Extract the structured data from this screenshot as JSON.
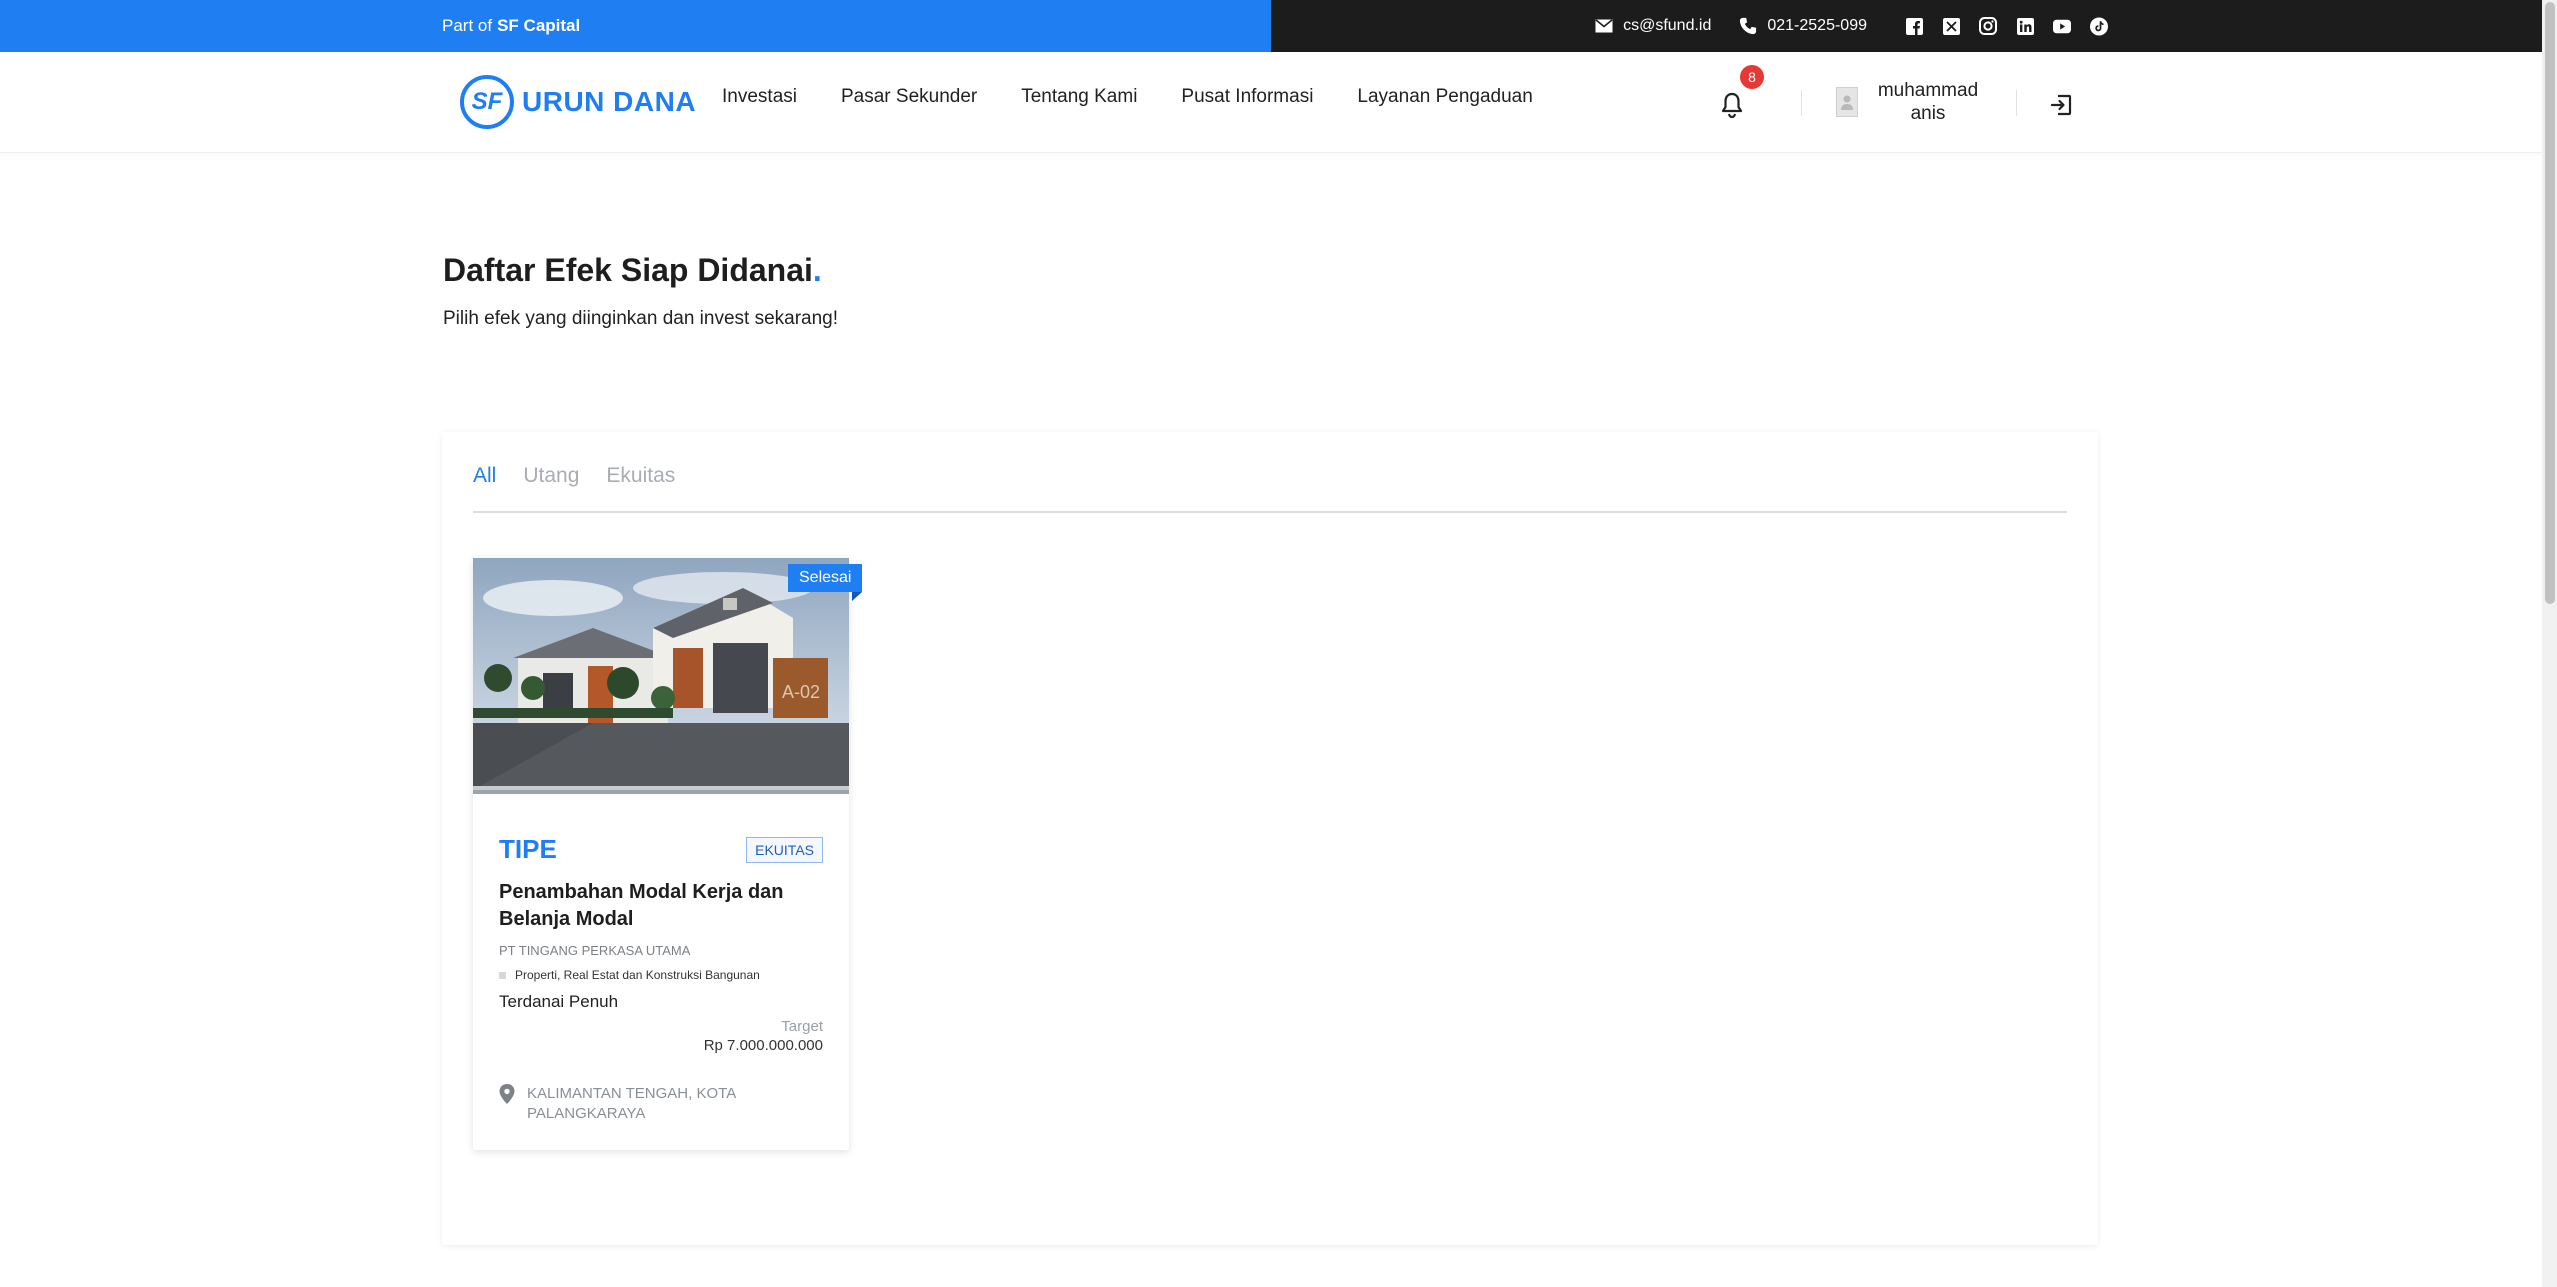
{
  "topbar": {
    "part_of": "Part of",
    "brand": "SF Capital",
    "email": "cs@sfund.id",
    "phone": "021-2525-099",
    "socials": [
      "facebook-icon",
      "x-icon",
      "instagram-icon",
      "linkedin-icon",
      "youtube-icon",
      "tiktok-icon"
    ]
  },
  "header": {
    "logo_mark": "SF",
    "logo_text": "URUN DANA",
    "nav": [
      "Investasi",
      "Pasar Sekunder",
      "Tentang Kami",
      "Pusat Informasi",
      "Layanan Pengaduan"
    ],
    "notif_count": "8",
    "user_first": "muhammad",
    "user_last": "anis"
  },
  "page": {
    "title": "Daftar Efek Siap Didanai",
    "title_dot": ".",
    "subtitle": "Pilih efek yang diinginkan dan invest sekarang!"
  },
  "tabs": [
    {
      "label": "All",
      "active": true
    },
    {
      "label": "Utang",
      "active": false
    },
    {
      "label": "Ekuitas",
      "active": false
    }
  ],
  "card": {
    "status": "Selesai",
    "image_label": "A-02",
    "type_label": "TIPE",
    "badge": "EKUITAS",
    "title": "Penambahan Modal Kerja dan Belanja Modal",
    "company": "PT TINGANG PERKASA UTAMA",
    "sector": "Properti, Real Estat dan Konstruksi Bangunan",
    "funding_status": "Terdanai Penuh",
    "target_label": "Target",
    "target_value": "Rp 7.000.000.000",
    "location": "KALIMANTAN TENGAH, KOTA PALANGKARAYA"
  },
  "colors": {
    "accent": "#1f7ef2",
    "topbar_dark": "#1c1c1c",
    "badge_red": "#e53935"
  }
}
